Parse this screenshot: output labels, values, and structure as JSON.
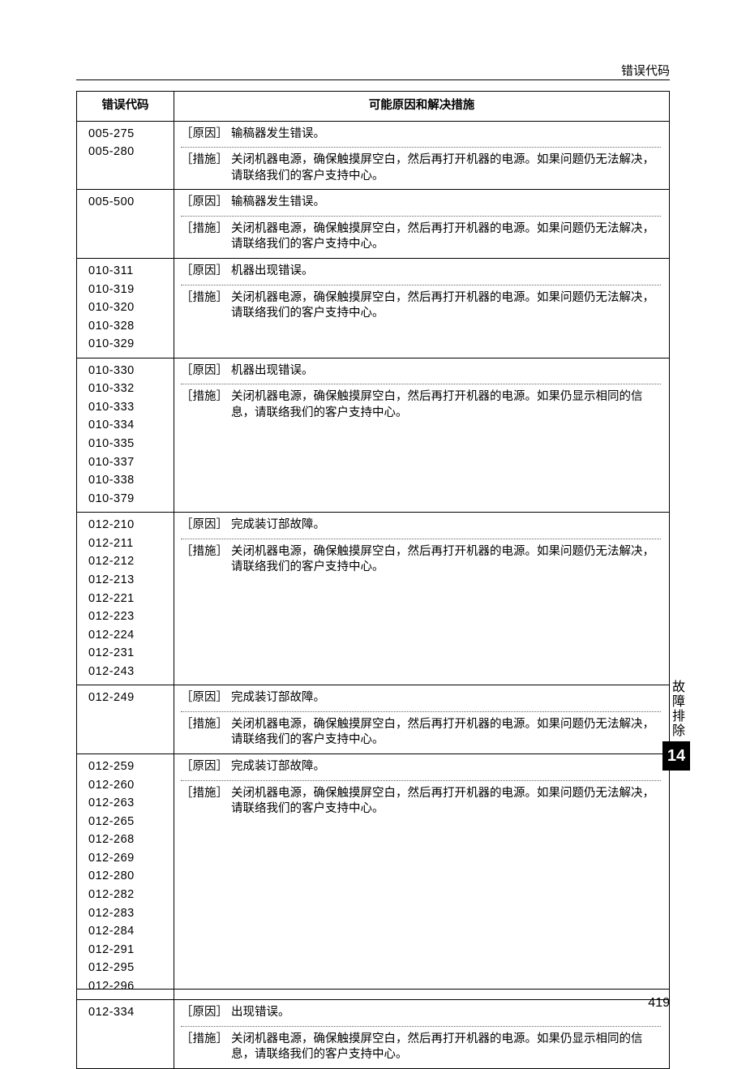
{
  "header": {
    "title": "错误代码"
  },
  "sideTab": {
    "label": "故障排除",
    "number": "14"
  },
  "pageNumber": "419",
  "table": {
    "headers": {
      "code": "错误代码",
      "content": "可能原因和解决措施"
    },
    "labels": {
      "cause": "［原因］",
      "action": "［措施］"
    },
    "rows": [
      {
        "codes": [
          "005-275",
          "005-280"
        ],
        "entries": [
          {
            "type": "cause",
            "text": "输稿器发生错误。"
          },
          {
            "type": "action",
            "text": "关闭机器电源，确保触摸屏空白，然后再打开机器的电源。如果问题仍无法解决，请联络我们的客户支持中心。"
          }
        ]
      },
      {
        "codes": [
          "005-500"
        ],
        "entries": [
          {
            "type": "cause",
            "text": "输稿器发生错误。"
          },
          {
            "type": "action",
            "text": "关闭机器电源，确保触摸屏空白，然后再打开机器的电源。如果问题仍无法解决，请联络我们的客户支持中心。"
          }
        ]
      },
      {
        "codes": [
          "010-311",
          "010-319",
          "010-320",
          "010-328",
          "010-329"
        ],
        "entries": [
          {
            "type": "cause",
            "text": "机器出现错误。"
          },
          {
            "type": "action",
            "text": "关闭机器电源，确保触摸屏空白，然后再打开机器的电源。如果问题仍无法解决，请联络我们的客户支持中心。"
          }
        ]
      },
      {
        "codes": [
          "010-330",
          "010-332",
          "010-333",
          "010-334",
          "010-335",
          "010-337",
          "010-338",
          "010-379"
        ],
        "entries": [
          {
            "type": "cause",
            "text": "机器出现错误。"
          },
          {
            "type": "action",
            "text": "关闭机器电源，确保触摸屏空白，然后再打开机器的电源。如果仍显示相同的信息，请联络我们的客户支持中心。"
          }
        ]
      },
      {
        "codes": [
          "012-210",
          "012-211",
          "012-212",
          "012-213",
          "012-221",
          "012-223",
          "012-224",
          "012-231",
          "012-243"
        ],
        "entries": [
          {
            "type": "cause",
            "text": "完成装订部故障。"
          },
          {
            "type": "action",
            "text": "关闭机器电源，确保触摸屏空白，然后再打开机器的电源。如果问题仍无法解决，请联络我们的客户支持中心。"
          }
        ]
      },
      {
        "codes": [
          "012-249"
        ],
        "entries": [
          {
            "type": "cause",
            "text": "完成装订部故障。"
          },
          {
            "type": "action",
            "text": "关闭机器电源，确保触摸屏空白，然后再打开机器的电源。如果问题仍无法解决，请联络我们的客户支持中心。"
          }
        ]
      },
      {
        "codes": [
          "012-259",
          "012-260",
          "012-263",
          "012-265",
          "012-268",
          "012-269",
          "012-280",
          "012-282",
          "012-283",
          "012-284",
          "012-291",
          "012-295",
          "012-296"
        ],
        "entries": [
          {
            "type": "cause",
            "text": "完成装订部故障。"
          },
          {
            "type": "action",
            "text": "关闭机器电源，确保触摸屏空白，然后再打开机器的电源。如果问题仍无法解决，请联络我们的客户支持中心。"
          }
        ]
      },
      {
        "codes": [
          "012-334"
        ],
        "entries": [
          {
            "type": "cause",
            "text": "出现错误。"
          },
          {
            "type": "action",
            "text": "关闭机器电源，确保触摸屏空白，然后再打开机器的电源。如果仍显示相同的信息，请联络我们的客户支持中心。"
          }
        ]
      }
    ]
  }
}
